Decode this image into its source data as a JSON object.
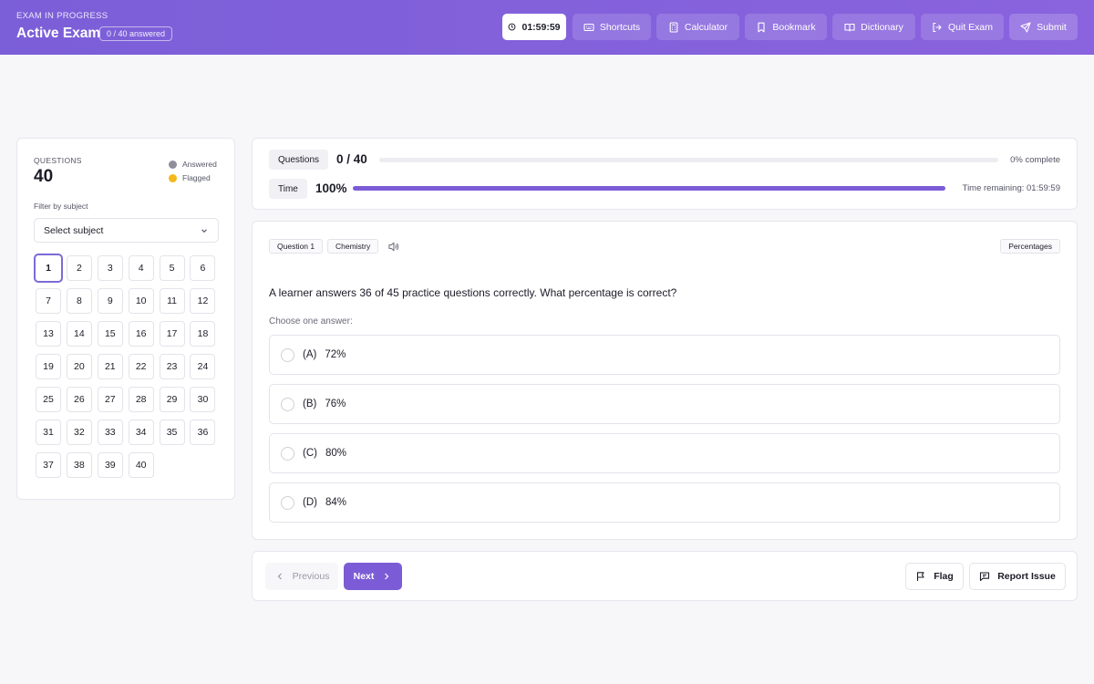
{
  "header": {
    "kicker": "EXAM IN PROGRESS",
    "title": "Active Exam",
    "answered_badge": "0 / 40 answered",
    "timer": "01:59:59",
    "buttons": {
      "shortcuts": "Shortcuts",
      "calculator": "Calculator",
      "bookmark": "Bookmark",
      "dictionary": "Dictionary",
      "quit": "Quit Exam",
      "submit": "Submit"
    }
  },
  "sidebar": {
    "label": "QUESTIONS",
    "count": "40",
    "legend": {
      "answered": "Answered",
      "flagged": "Flagged"
    },
    "filter_label": "Filter by subject",
    "select_value": "Select subject",
    "current_question": "1",
    "questions": [
      "1",
      "2",
      "3",
      "4",
      "5",
      "6",
      "7",
      "8",
      "9",
      "10",
      "11",
      "12",
      "13",
      "14",
      "15",
      "16",
      "17",
      "18",
      "19",
      "20",
      "21",
      "22",
      "23",
      "24",
      "25",
      "26",
      "27",
      "28",
      "29",
      "30",
      "31",
      "32",
      "33",
      "34",
      "35",
      "36",
      "37",
      "38",
      "39",
      "40"
    ]
  },
  "progress": {
    "questions_label": "Questions",
    "questions_value": "0 / 40",
    "questions_fraction": 0,
    "percent_complete": "0% complete",
    "time_label": "Time",
    "time_value": "100%",
    "time_fraction": 1,
    "time_remaining": "Time remaining: 01:59:59"
  },
  "question": {
    "number_tag": "Question 1",
    "subject_tag": "Chemistry",
    "topic_tag": "Percentages",
    "text": "A learner answers 36 of 45 practice questions correctly. What percentage is correct?",
    "instruction": "Choose one answer:",
    "options": [
      {
        "letter": "(A)",
        "text": "72%"
      },
      {
        "letter": "(B)",
        "text": "76%"
      },
      {
        "letter": "(C)",
        "text": "80%"
      },
      {
        "letter": "(D)",
        "text": "84%"
      }
    ]
  },
  "footer": {
    "previous": "Previous",
    "next": "Next",
    "flag": "Flag",
    "report": "Report Issue"
  },
  "colors": {
    "accent": "#7c5cd6",
    "answered_dot": "#8e8e9a",
    "flagged_dot": "#f4b81c"
  }
}
